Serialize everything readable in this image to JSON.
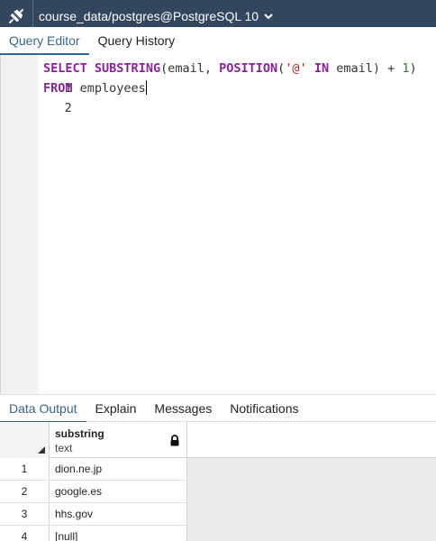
{
  "connection": {
    "title": "course_data/postgres@PostgreSQL 10",
    "icon": "connection-plug-icon"
  },
  "editor_tabs": [
    {
      "label": "Query Editor",
      "active": true
    },
    {
      "label": "Query History",
      "active": false
    }
  ],
  "editor": {
    "lines": [
      {
        "number": "1",
        "tokens": [
          {
            "t": "kw",
            "v": "SELECT"
          },
          {
            "t": "plain",
            "v": " "
          },
          {
            "t": "kw",
            "v": "SUBSTRING"
          },
          {
            "t": "plain",
            "v": "(email, "
          },
          {
            "t": "kw",
            "v": "POSITION"
          },
          {
            "t": "plain",
            "v": "("
          },
          {
            "t": "str",
            "v": "'@'"
          },
          {
            "t": "plain",
            "v": " "
          },
          {
            "t": "kw",
            "v": "IN"
          },
          {
            "t": "plain",
            "v": " email) + "
          },
          {
            "t": "num",
            "v": "1"
          },
          {
            "t": "plain",
            "v": ")"
          }
        ]
      },
      {
        "number": "2",
        "tokens": [
          {
            "t": "kw",
            "v": "FROM"
          },
          {
            "t": "plain",
            "v": " employees"
          }
        ]
      }
    ]
  },
  "result_tabs": [
    {
      "label": "Data Output",
      "active": true
    },
    {
      "label": "Explain",
      "active": false
    },
    {
      "label": "Messages",
      "active": false
    },
    {
      "label": "Notifications",
      "active": false
    }
  ],
  "grid": {
    "column": {
      "name": "substring",
      "type": "text"
    },
    "rows": [
      {
        "n": "1",
        "value": "dion.ne.jp"
      },
      {
        "n": "2",
        "value": "google.es"
      },
      {
        "n": "3",
        "value": "hhs.gov"
      },
      {
        "n": "4",
        "value": "[null]"
      }
    ]
  },
  "colors": {
    "topbar": "#32465e",
    "accent": "#326690",
    "keyword": "#8a1f9a",
    "string": "#b22222",
    "number": "#2d7d2d"
  }
}
